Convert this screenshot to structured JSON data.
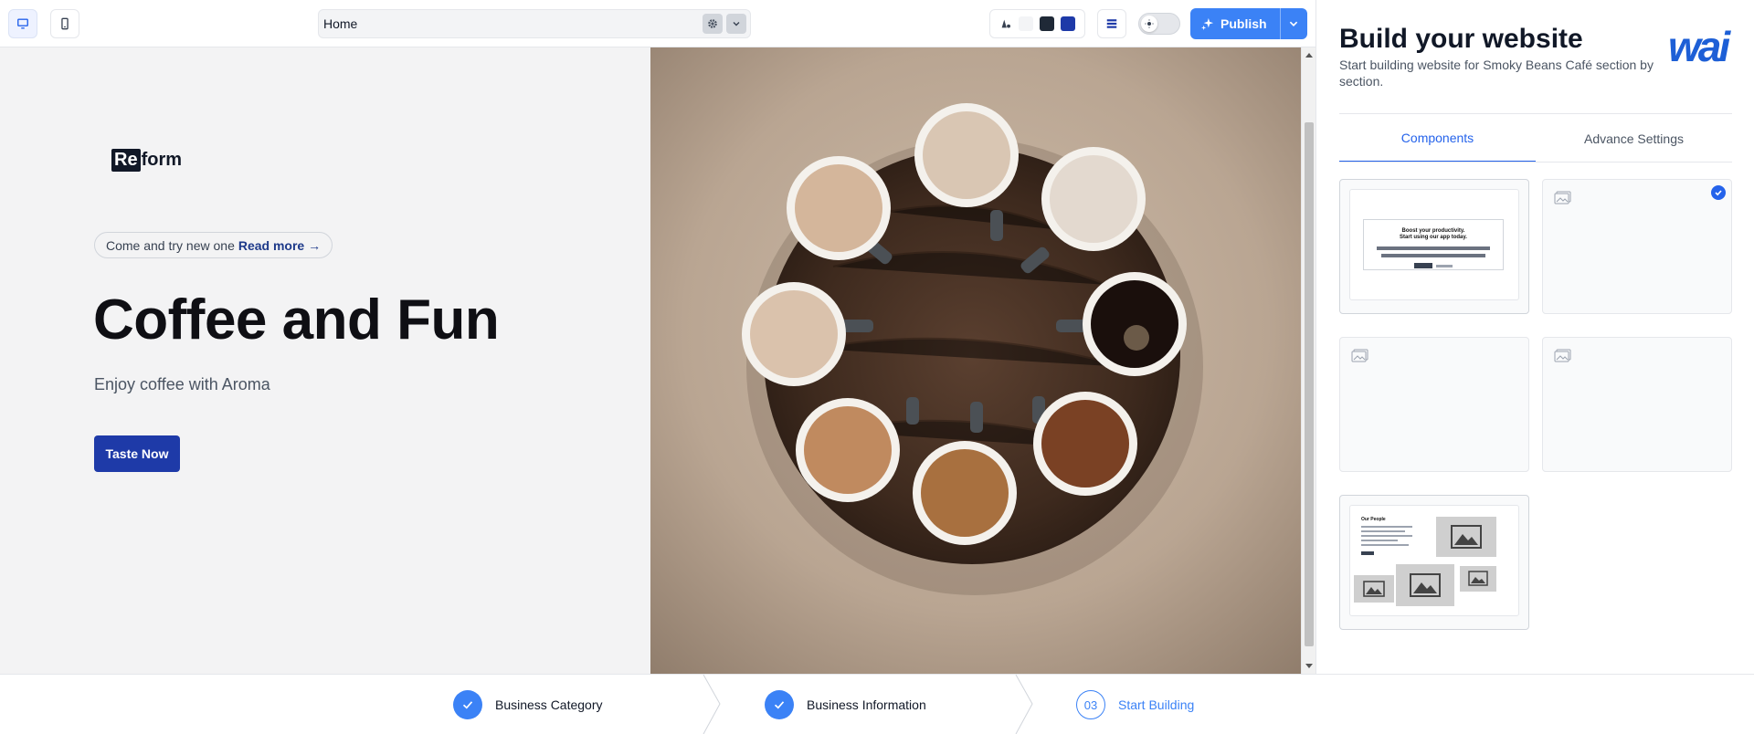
{
  "toolbar": {
    "page_selected": "Home",
    "publish_label": "Publish",
    "palette_colors": [
      "#f3f4f6",
      "#1f2937",
      "#1e3aa8"
    ]
  },
  "hero": {
    "logo_part1": "Re",
    "logo_part2": "form",
    "pill_text": "Come and try new one",
    "pill_link": "Read more →",
    "title": "Coffee and Fun",
    "subtitle": "Enjoy coffee with Aroma",
    "cta_label": "Taste Now"
  },
  "panel": {
    "title": "Build your website",
    "subtitle": "Start building website for Smoky Beans Café section by section.",
    "brand": "wai",
    "tabs": [
      {
        "label": "Components",
        "active": true
      },
      {
        "label": "Advance Settings",
        "active": false
      }
    ],
    "card1_lines": [
      "Boost your productivity.",
      "Start using our app today."
    ],
    "card5_heading": "Our People"
  },
  "stepper": {
    "steps": [
      {
        "label": "Business Category",
        "state": "done"
      },
      {
        "label": "Business Information",
        "state": "done"
      },
      {
        "number": "03",
        "label": "Start Building",
        "state": "current"
      }
    ]
  },
  "colors": {
    "accent": "#3b82f6",
    "cta": "#1e3aa8",
    "brand": "#1d5fd6"
  }
}
